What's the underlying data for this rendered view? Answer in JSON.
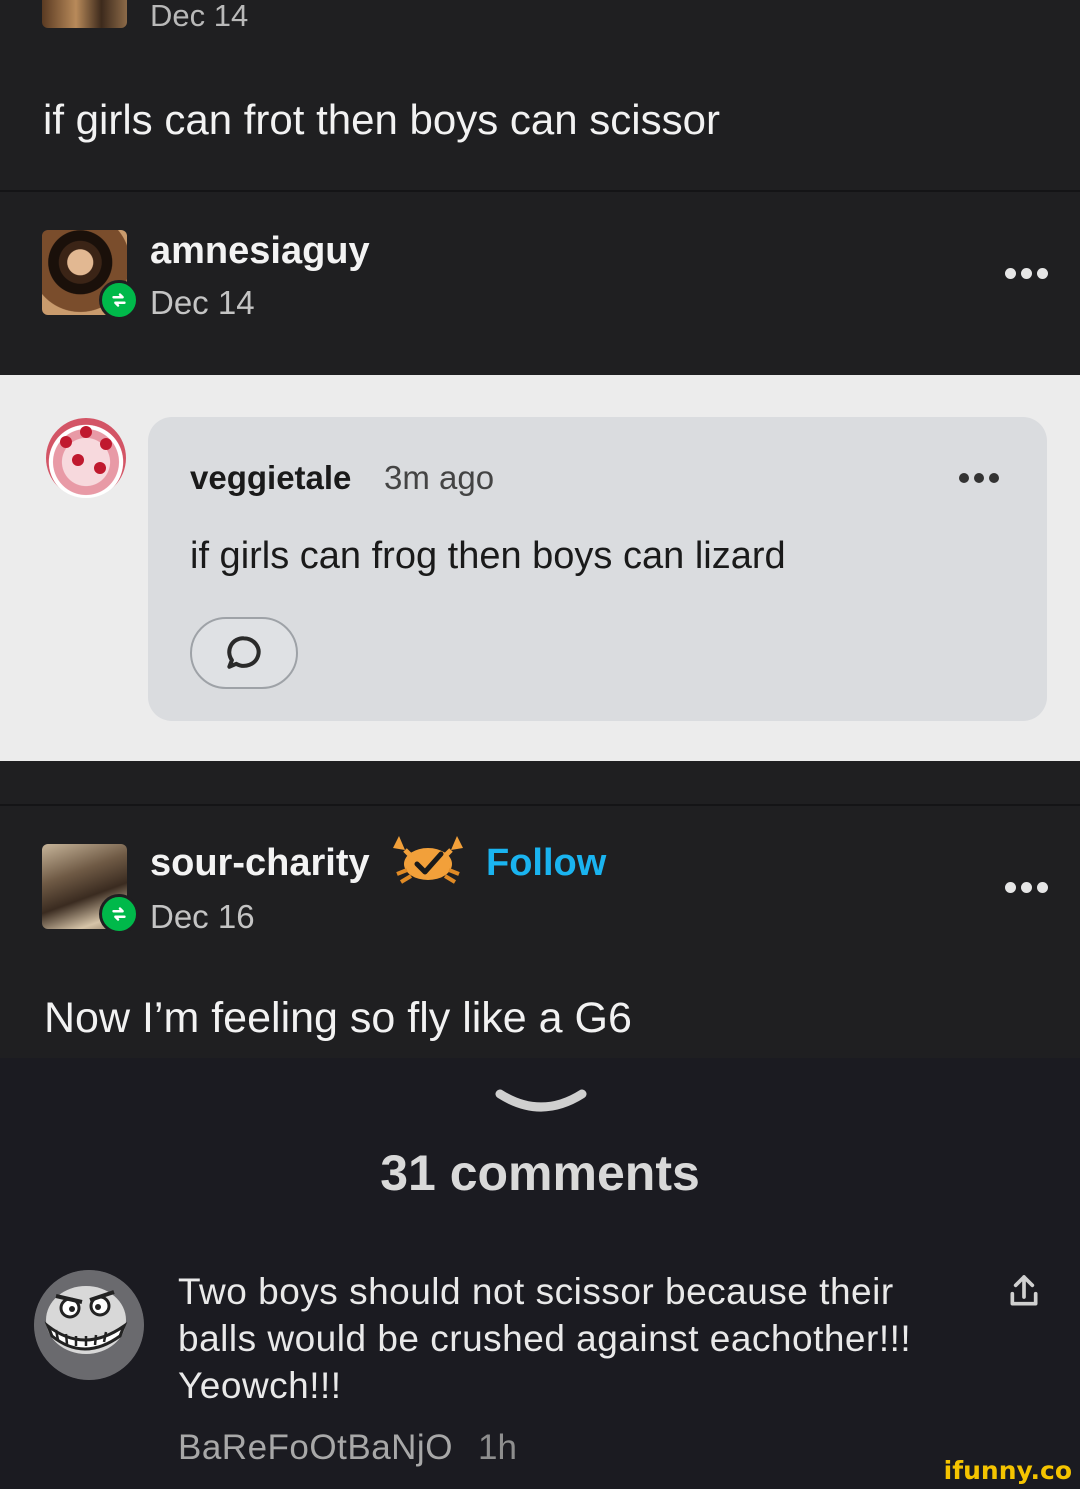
{
  "top_post": {
    "date": "Dec 14",
    "body": "if girls can frot then boys can scissor"
  },
  "reblog_1": {
    "username": "amnesiaguy",
    "date": "Dec 14"
  },
  "comment_card": {
    "username": "veggietale",
    "time": "3m ago",
    "text": "if girls can frog then boys can lizard"
  },
  "reblog_2": {
    "username": "sour-charity",
    "follow_label": "Follow",
    "date": "Dec 16",
    "body": "Now I’m feeling so fly like a G6"
  },
  "comments": {
    "count_label": "31 comments",
    "items": [
      {
        "text": "Two boys should not scissor because their balls would be crushed against eachother!!! Yeowch!!!",
        "author": "BaReFoOtBaNjO",
        "time": "1h"
      }
    ]
  },
  "watermark": "ifunny.co",
  "colors": {
    "reblog_badge": "#00b94a",
    "follow": "#1ab4f0",
    "watermark": "#f5c400"
  }
}
